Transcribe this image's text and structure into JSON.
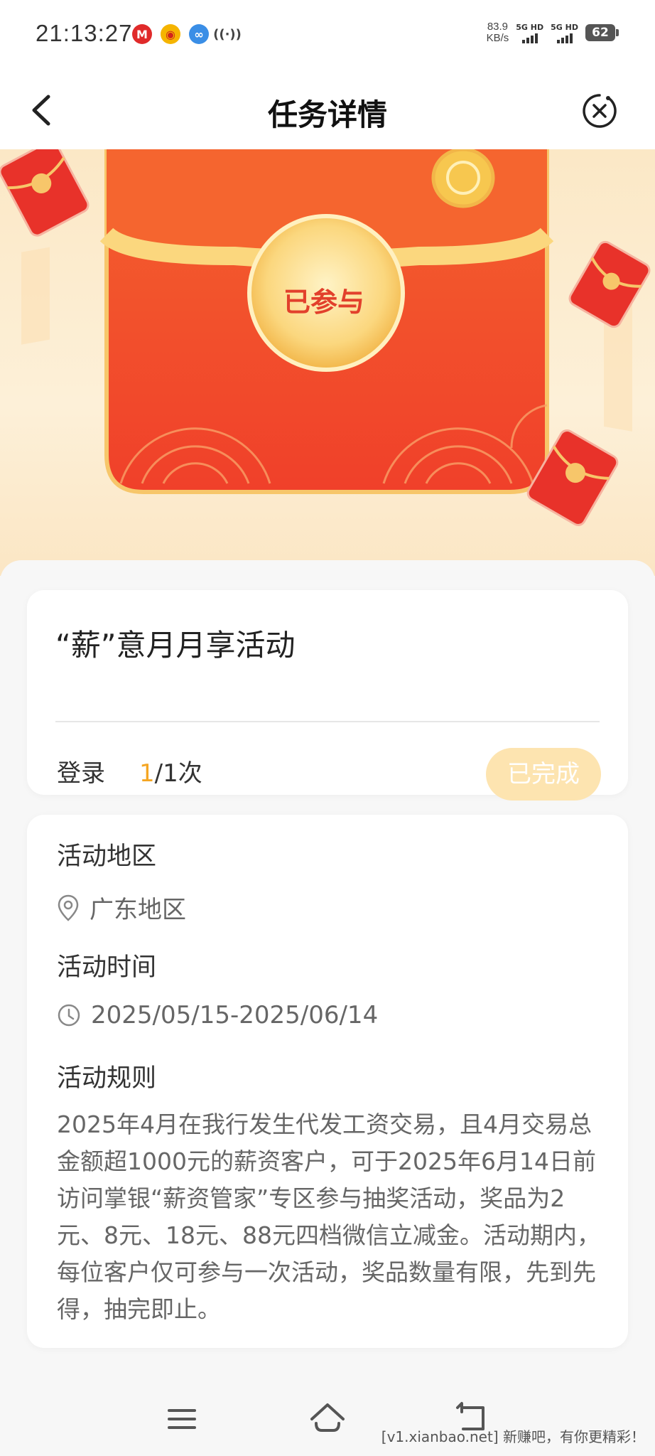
{
  "status_bar": {
    "time": "21:13:27",
    "net_speed_value": "83.9",
    "net_speed_unit": "KB/s",
    "sim1": "5G HD",
    "sim2": "5G HD",
    "battery": "62",
    "icons": [
      "metro-icon",
      "weibo-icon",
      "app-icon",
      "hotspot-icon"
    ]
  },
  "header": {
    "title": "任务详情",
    "back_icon": "chevron-left-icon",
    "close_icon": "close-circle-icon"
  },
  "banner": {
    "status_label": "已参与",
    "colors": {
      "red": "#f04a2a",
      "gold": "#fbd77e",
      "bg": "#fbe8c6"
    }
  },
  "task": {
    "title": "“薪”意月月享活动",
    "action_label": "登录",
    "progress_current": "1",
    "progress_rest": "/1次",
    "button_label": "已完成"
  },
  "info": {
    "region_title": "活动地区",
    "region_value": "广东地区",
    "time_title": "活动时间",
    "time_value": "2025/05/15-2025/06/14",
    "rules_title": "活动规则",
    "rules_text": "2025年4月在我行发生代发工资交易，且4月交易总金额超1000元的薪资客户，可于2025年6月14日前访问掌银“薪资管家”专区参与抽奖活动，奖品为2元、8元、18元、88元四档微信立减金。活动期内，每位客户仅可参与一次活动，奖品数量有限，先到先得，抽完即止。"
  },
  "nav": {
    "icons": [
      "menu-icon",
      "home-icon",
      "back-icon"
    ]
  },
  "watermark": "[v1.xianbao.net] 新赚吧，有你更精彩！"
}
